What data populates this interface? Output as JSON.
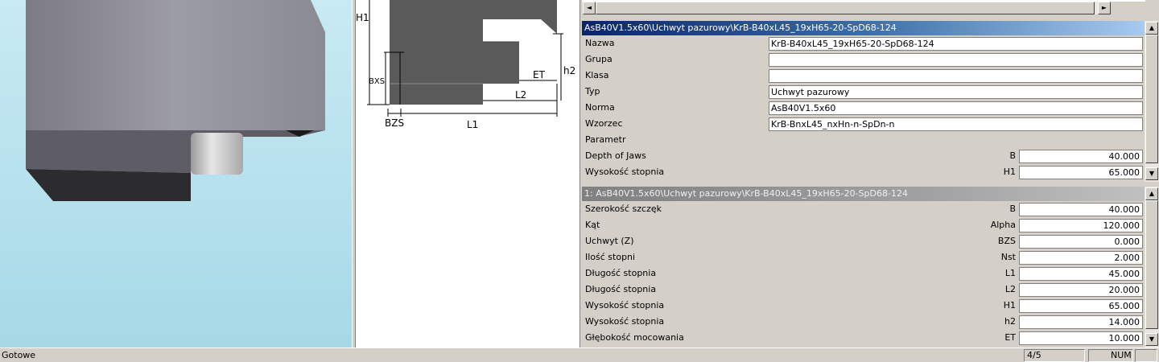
{
  "drawing": {
    "labels": {
      "h1": "H1",
      "bxs": "BXS",
      "bzs": "BZS",
      "l1": "L1",
      "l2": "L2",
      "et": "ET",
      "h2": "h2"
    }
  },
  "panel1": {
    "header": "AsB40V1.5x60\\Uchwyt pazurowy\\KrB-B40xL45_19xH65-20-SpD68-124",
    "rows": [
      {
        "label": "Nazwa",
        "value": "KrB-B40xL45_19xH65-20-SpD68-124"
      },
      {
        "label": "Grupa",
        "value": ""
      },
      {
        "label": "Klasa",
        "value": ""
      },
      {
        "label": "Typ",
        "value": "Uchwyt pazurowy"
      },
      {
        "label": "Norma",
        "value": "AsB40V1.5x60"
      },
      {
        "label": "Wzorzec",
        "value": "KrB-BnxL45_nxHn-n-SpDn-n"
      }
    ],
    "section_label": "Parametr",
    "params": [
      {
        "label": "Depth of Jaws",
        "code": "B",
        "value": "40.000"
      },
      {
        "label": "Wysokość stopnia",
        "code": "H1",
        "value": "65.000"
      }
    ]
  },
  "panel2": {
    "header": "1: AsB40V1.5x60\\Uchwyt pazurowy\\KrB-B40xL45_19xH65-20-SpD68-124",
    "params": [
      {
        "label": "Szerokość szczęk",
        "code": "B",
        "value": "40.000"
      },
      {
        "label": "Kąt",
        "code": "Alpha",
        "value": "120.000"
      },
      {
        "label": "Uchwyt (Z)",
        "code": "BZS",
        "value": "0.000"
      },
      {
        "label": "Ilość stopni",
        "code": "Nst",
        "value": "2.000"
      },
      {
        "label": "Długość stopnia",
        "code": "L1",
        "value": "45.000"
      },
      {
        "label": "Długość stopnia",
        "code": "L2",
        "value": "20.000"
      },
      {
        "label": "Wysokość stopnia",
        "code": "H1",
        "value": "65.000"
      },
      {
        "label": "Wysokość stopnia",
        "code": "h2",
        "value": "14.000"
      },
      {
        "label": "Głębokość mocowania",
        "code": "ET",
        "value": "10.000"
      }
    ]
  },
  "status": {
    "message": "Gotowe",
    "page": "4/5",
    "num": "NUM"
  },
  "icons": {
    "scroll_left": "arrow-left-icon",
    "scroll_right": "arrow-right-icon",
    "scroll_up": "arrow-up-icon",
    "scroll_down": "arrow-down-icon"
  }
}
